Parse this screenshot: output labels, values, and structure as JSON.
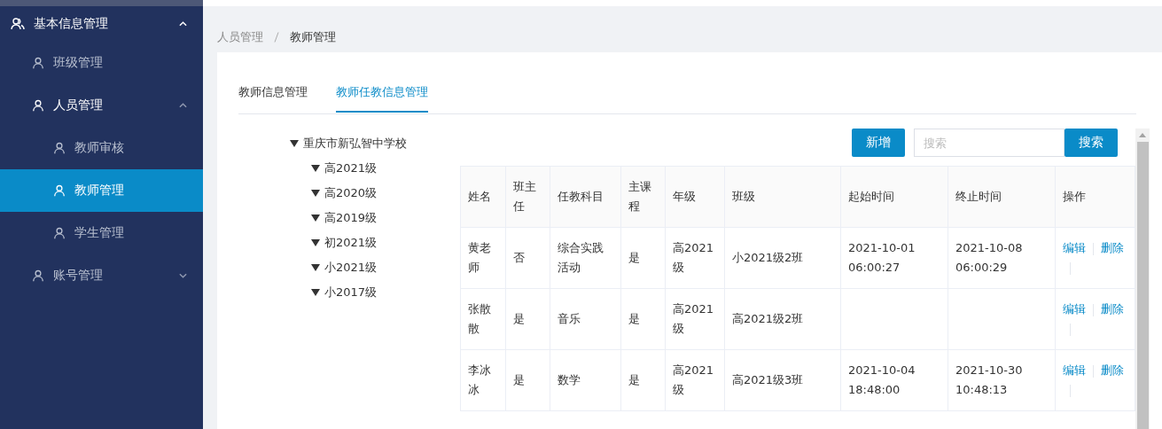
{
  "sidebar": {
    "items": [
      {
        "label": "基本信息管理",
        "expanded": true,
        "selected": false,
        "children": [
          {
            "label": "班级管理",
            "selected": false
          },
          {
            "label": "人员管理",
            "expanded": true,
            "selected": false,
            "children": [
              {
                "label": "教师审核",
                "selected": false
              },
              {
                "label": "教师管理",
                "selected": true
              },
              {
                "label": "学生管理",
                "selected": false
              }
            ]
          },
          {
            "label": "账号管理",
            "expanded": false,
            "selected": false
          }
        ]
      }
    ]
  },
  "breadcrumb": [
    "人员管理",
    "教师管理"
  ],
  "tabs": [
    {
      "label": "教师信息管理",
      "selected": false
    },
    {
      "label": "教师任教信息管理",
      "selected": true
    }
  ],
  "tree": {
    "label": "重庆市新弘智中学校",
    "expanded": true,
    "children": [
      {
        "label": "高2021级",
        "expanded": true
      },
      {
        "label": "高2020级",
        "expanded": true
      },
      {
        "label": "高2019级",
        "expanded": true
      },
      {
        "label": "初2021级",
        "expanded": true
      },
      {
        "label": "小2021级",
        "expanded": true
      },
      {
        "label": "小2017级",
        "expanded": true
      }
    ]
  },
  "toolbar": {
    "add_button": "新增",
    "search": {
      "placeholder": "搜索"
    },
    "search_button": "搜索"
  },
  "table": {
    "columns": [
      "姓名",
      "班主任",
      "任教科目",
      "主课程",
      "年级",
      "班级",
      "起始时间",
      "终止时间",
      "操作"
    ],
    "rows": [
      {
        "cells": [
          "黄老师",
          "否",
          "综合实践活动",
          "是",
          "高2021级",
          "小2021级2班",
          "2021-10-01 06:00:27",
          "2021-10-08 06:00:29"
        ],
        "actions": [
          "编辑",
          "删除"
        ]
      },
      {
        "cells": [
          "张散散",
          "是",
          "音乐",
          "是",
          "高2021级",
          "高2021级2班",
          "",
          ""
        ],
        "actions": [
          "编辑",
          "删除"
        ]
      },
      {
        "cells": [
          "李冰冰",
          "是",
          "数学",
          "是",
          "高2021级",
          "高2021级3班",
          "2021-10-04 18:48:00",
          "2021-10-30 10:48:13"
        ],
        "actions": [
          "编辑",
          "删除"
        ]
      }
    ]
  }
}
